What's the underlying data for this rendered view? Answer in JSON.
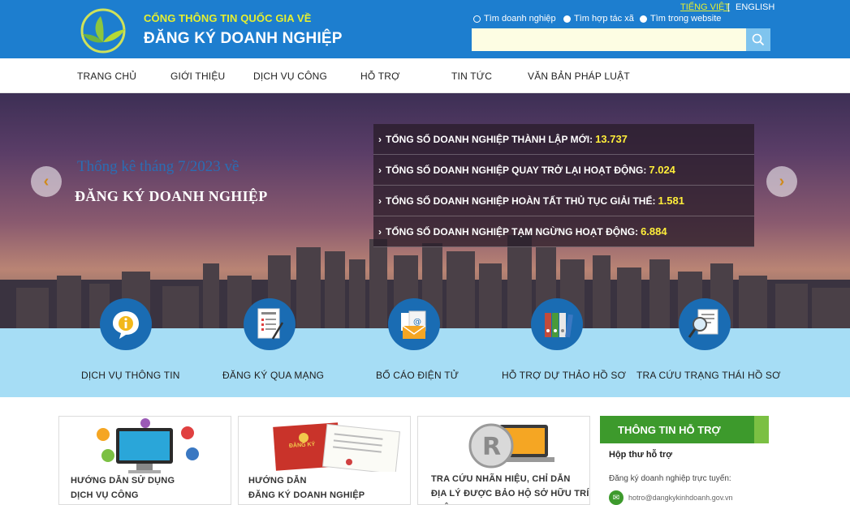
{
  "header": {
    "subtitle": "CỔNG THÔNG TIN QUỐC GIA VỀ",
    "title": "ĐĂNG KÝ DOANH NGHIỆP",
    "lang_vi": "TIẾNG VIỆT",
    "lang_sep": "|",
    "lang_en": "ENGLISH",
    "search_options": [
      "Tìm doanh nghiệp",
      "Tìm hợp tác xã",
      "Tìm trong website"
    ],
    "search_placeholder": ""
  },
  "nav": {
    "items": [
      "TRANG CHỦ",
      "GIỚI THIỆU",
      "DỊCH VỤ CÔNG",
      "HỖ TRỢ",
      "TIN TỨC",
      "VĂN BẢN PHÁP LUẬT"
    ]
  },
  "hero": {
    "line1": "Thống kê tháng 7/2023 về",
    "line2": "ĐĂNG KÝ DOANH NGHIỆP",
    "stats": [
      {
        "label": "TỔNG SỐ DOANH NGHIỆP THÀNH LẬP MỚI:",
        "value": "13.737"
      },
      {
        "label": "TỔNG SỐ DOANH NGHIỆP QUAY TRỞ LẠI HOẠT ĐỘNG:",
        "value": "7.024"
      },
      {
        "label": "TỔNG SỐ DOANH NGHIỆP HOÀN TẤT THỦ TỤC GIẢI THỂ:",
        "value": "1.581"
      },
      {
        "label": "TỔNG SỐ DOANH NGHIỆP TẠM NGỪNG HOẠT ĐỘNG:",
        "value": "6.884"
      }
    ],
    "prev_icon": "chevron-left-icon",
    "next_icon": "chevron-right-icon"
  },
  "services": [
    {
      "label": "DỊCH VỤ THÔNG TIN",
      "icon": "info-icon"
    },
    {
      "label": "ĐĂNG KÝ QUA MẠNG",
      "icon": "form-icon"
    },
    {
      "label": "BỐ CÁO ĐIỆN TỬ",
      "icon": "email-icon"
    },
    {
      "label": "HỖ TRỢ DỰ THẢO HỒ SƠ",
      "icon": "binders-icon"
    },
    {
      "label": "TRA CỨU TRẠNG THÁI HỒ SƠ",
      "icon": "magnifier-icon"
    }
  ],
  "cards": [
    {
      "line1": "HƯỚNG DẪN SỬ DỤNG",
      "line2": "DỊCH VỤ CÔNG"
    },
    {
      "line1": "HƯỚNG DẪN",
      "line2": "ĐĂNG KÝ DOANH NGHIỆP",
      "image_text": "ĐĂNG KÝ"
    },
    {
      "line1": "TRA CỨU NHÃN HIỆU, CHỈ DẪN",
      "line2": "ĐỊA LÝ ĐƯỢC BẢO HỘ SỞ HỮU TRÍ TUỆ"
    }
  ],
  "support": {
    "heading": "THÔNG TIN HỖ TRỢ",
    "title": "Hộp thư hỗ trợ",
    "desc": "Đăng ký doanh nghiệp trực tuyến:",
    "email": "hotro@dangkykinhdoanh.gov.vn"
  },
  "colors": {
    "header_bg": "#1d7ecf",
    "accent_yellow": "#e6ef2f",
    "services_bg": "#a6ddf5",
    "support_green": "#3d9a2c"
  }
}
